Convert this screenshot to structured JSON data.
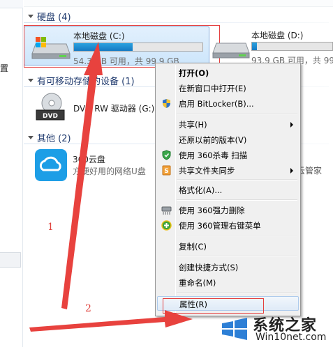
{
  "nav": {
    "partial_text": "置"
  },
  "groups": {
    "hard_disks": {
      "title": "硬盘 (4)"
    },
    "removable": {
      "title": "有可移动存储的设备 (1)"
    },
    "other": {
      "title": "其他 (2)"
    }
  },
  "drives": [
    {
      "name": "本地磁盘 (C:)",
      "size_text": "54.3 GB 可用，共 99.9 GB",
      "used_percent": 45.6
    },
    {
      "name": "本地磁盘 (D:)",
      "size_text": "93.9 GB 可用，共 99.",
      "used_percent": 6
    }
  ],
  "dvd": {
    "name": "DVD RW 驱动器 (G:)",
    "icon_text": "DVD"
  },
  "other_items": {
    "cloud_name": "360云盘",
    "cloud_desc": "方便好用的网络U盘",
    "partial_text": "云管家"
  },
  "context_menu": {
    "items": [
      {
        "label": "打开(O)",
        "bold": true,
        "icon": "none"
      },
      {
        "label": "在新窗口中打开(E)",
        "icon": "none"
      },
      {
        "label": "启用 BitLocker(B)...",
        "icon": "shield-icon"
      },
      {
        "label": "共享(H)",
        "icon": "none",
        "submenu": true
      },
      {
        "label": "还原以前的版本(V)",
        "icon": "none"
      },
      {
        "label": "使用 360杀毒 扫描",
        "icon": "antivirus-shield-icon"
      },
      {
        "label": "共享文件夹同步",
        "icon": "sync-icon",
        "submenu": true
      },
      {
        "label": "格式化(A)...",
        "icon": "none"
      },
      {
        "label": "使用 360强力删除",
        "icon": "shredder-icon"
      },
      {
        "label": "使用 360管理右键菜单",
        "icon": "plus-icon"
      },
      {
        "label": "复制(C)",
        "icon": "none"
      },
      {
        "label": "创建快捷方式(S)",
        "icon": "none"
      },
      {
        "label": "重命名(M)",
        "icon": "none"
      },
      {
        "label": "属性(R)",
        "icon": "none",
        "highlighted": true
      }
    ]
  },
  "annotations": {
    "step1": "1",
    "step2": "2"
  },
  "watermark": {
    "title": "系统之家",
    "url": "Win10net.com"
  },
  "colors": {
    "accent_blue": "#1679c2",
    "annotation_red": "#e43f3f",
    "selection_bg": "#cde6fb"
  }
}
